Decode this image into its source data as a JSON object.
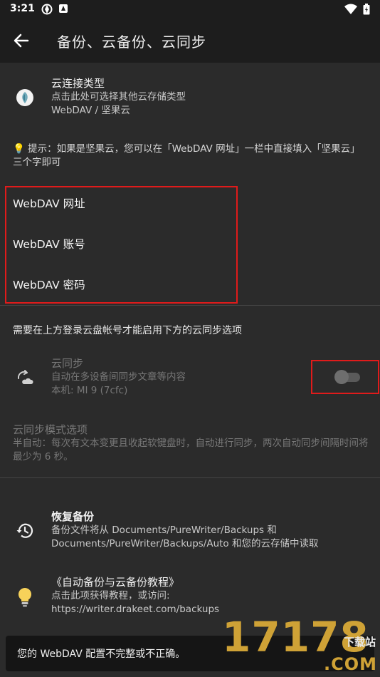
{
  "status_bar": {
    "time": "3:21"
  },
  "app_bar": {
    "title": "备份、云备份、云同步"
  },
  "cloud_type": {
    "title": "云连接类型",
    "subtitle": "点击此处可选择其他云存储类型",
    "value": "WebDAV / 坚果云"
  },
  "hint": {
    "text": "💡 提示：如果是坚果云，您可以在「WebDAV 网址」一栏中直接填入「坚果云」三个字即可"
  },
  "webdav": {
    "url_label": "WebDAV 网址",
    "account_label": "WebDAV 账号",
    "password_label": "WebDAV 密码"
  },
  "sync_note": "需要在上方登录云盘帐号才能启用下方的云同步选项",
  "cloud_sync": {
    "title": "云同步",
    "subtitle": "自动在多设备间同步文章等内容",
    "device": "本机: MI 9 (7cfc)",
    "enabled": false
  },
  "sync_mode": {
    "title": "云同步模式选项",
    "subtitle": "半自动：每次有文本变更且收起软键盘时，自动进行同步，两次自动同步间隔时间将最少为 6 秒。"
  },
  "restore": {
    "title": "恢复备份",
    "subtitle": "备份文件将从 Documents/PureWriter/Backups 和 Documents/PureWriter/Backups/Auto 和您的云存储中读取"
  },
  "tutorial": {
    "title": "《自动备份与云备份教程》",
    "subtitle": "点击此项获得教程，或访问:",
    "url": "https://writer.drakeet.com/backups"
  },
  "snackbar": {
    "text": "您的 WebDAV 配置不完整或不正确。"
  },
  "watermark": {
    "digits": "17178",
    "cn": "下载站",
    "com": ".COM"
  },
  "colors": {
    "highlight": "#e01b1b",
    "background": "#2b2b2b",
    "bar": "#1d1d1d",
    "watermark": "#cfa236"
  }
}
